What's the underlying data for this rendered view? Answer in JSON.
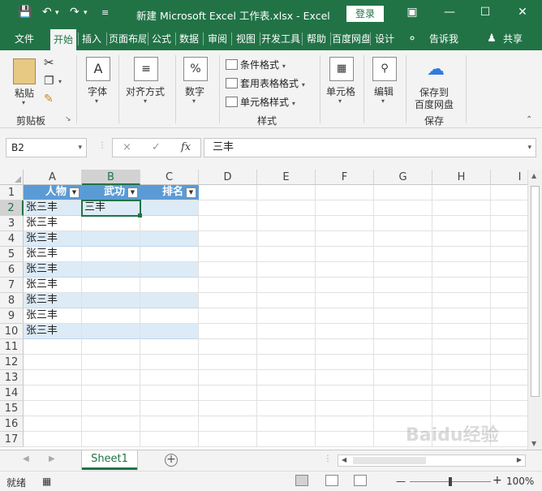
{
  "window": {
    "title": "新建 Microsoft Excel 工作表.xlsx  -  Excel",
    "login_label": "登录",
    "qat": [
      "save-icon",
      "undo-icon",
      "redo-icon",
      "customize-icon"
    ]
  },
  "tabs": [
    {
      "label": "文件",
      "active": false
    },
    {
      "label": "开始",
      "active": true
    },
    {
      "label": "插入",
      "active": false
    },
    {
      "label": "页面布局",
      "active": false
    },
    {
      "label": "公式",
      "active": false
    },
    {
      "label": "数据",
      "active": false
    },
    {
      "label": "审阅",
      "active": false
    },
    {
      "label": "视图",
      "active": false
    },
    {
      "label": "开发工具",
      "active": false
    },
    {
      "label": "帮助",
      "active": false
    },
    {
      "label": "百度网盘",
      "active": false
    },
    {
      "label": "设计",
      "active": false
    },
    {
      "label": "告诉我",
      "active": false
    },
    {
      "label": "共享",
      "active": false
    }
  ],
  "ribbon": {
    "clipboard": {
      "paste": "粘贴",
      "group": "剪贴板"
    },
    "font": {
      "label": "字体"
    },
    "align": {
      "label": "对齐方式"
    },
    "number": {
      "label": "数字"
    },
    "styles": {
      "cond_format": "条件格式",
      "table_format": "套用表格格式",
      "cell_style": "单元格样式",
      "group": "样式"
    },
    "cells": {
      "label": "单元格"
    },
    "edit": {
      "label": "编辑"
    },
    "baidu": {
      "line1": "保存到",
      "line2": "百度网盘",
      "group": "保存"
    }
  },
  "formula_bar": {
    "name_box": "B2",
    "fx": "fx",
    "cancel": "×",
    "enter": "✓",
    "content": "三丰"
  },
  "grid": {
    "columns": [
      "A",
      "B",
      "C",
      "D",
      "E",
      "F",
      "G",
      "H",
      "I"
    ],
    "rows": [
      "1",
      "2",
      "3",
      "4",
      "5",
      "6",
      "7",
      "8",
      "9",
      "10",
      "11",
      "12",
      "13",
      "14",
      "15",
      "16",
      "17"
    ],
    "selected_cell": "B2",
    "table_headers": [
      "人物",
      "武功",
      "排名"
    ],
    "table_rows": [
      [
        "张三丰",
        "三丰",
        ""
      ],
      [
        "张三丰",
        "",
        ""
      ],
      [
        "张三丰",
        "",
        ""
      ],
      [
        "张三丰",
        "",
        ""
      ],
      [
        "张三丰",
        "",
        ""
      ],
      [
        "张三丰",
        "",
        ""
      ],
      [
        "张三丰",
        "",
        ""
      ],
      [
        "张三丰",
        "",
        ""
      ],
      [
        "张三丰",
        "",
        ""
      ]
    ]
  },
  "sheets": {
    "active": "Sheet1"
  },
  "status": {
    "ready": "就绪",
    "zoom": "100%"
  },
  "watermark": "Baidu经验",
  "colors": {
    "excel_green": "#217346",
    "table_header": "#5b9bd5",
    "band": "#ddebf7"
  }
}
